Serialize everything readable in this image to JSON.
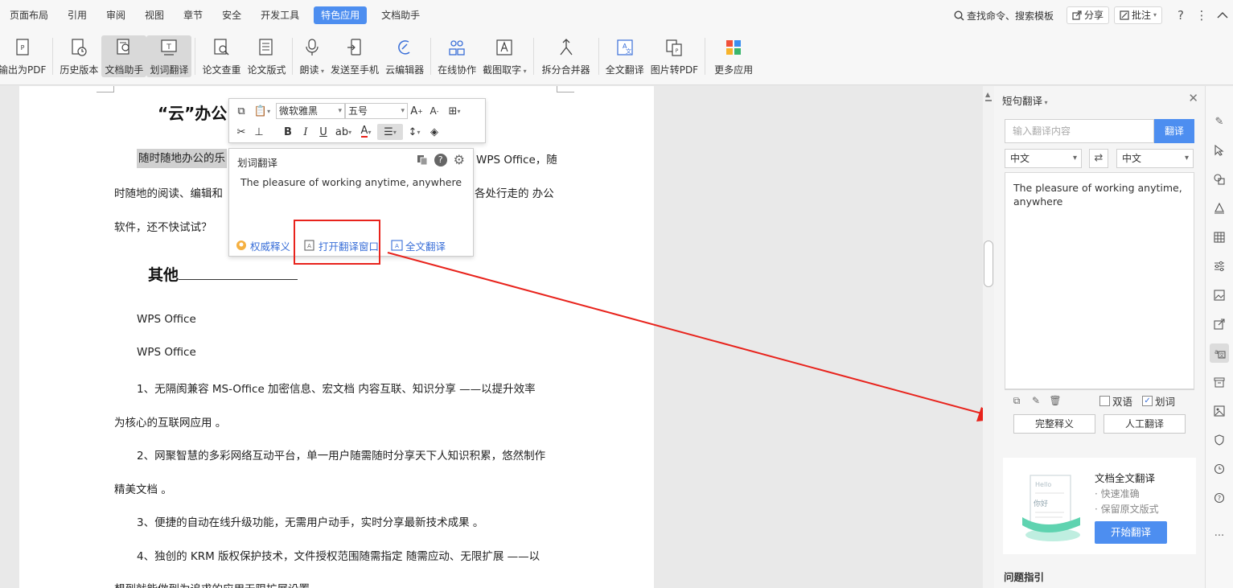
{
  "menubar": {
    "items": [
      "页面布局",
      "引用",
      "审阅",
      "视图",
      "章节",
      "安全",
      "开发工具",
      "特色应用",
      "文档助手"
    ],
    "active": "特色应用",
    "search_label": "查找命令、搜索模板",
    "share_label": "分享",
    "comment_label": "批注"
  },
  "toolbar": {
    "buttons": [
      {
        "label": "输出为PDF",
        "icon": "pdf-export-icon"
      },
      {
        "label": "历史版本",
        "icon": "history-icon"
      },
      {
        "label": "文档助手",
        "icon": "doc-assistant-icon"
      },
      {
        "label": "划词翻译",
        "icon": "word-translate-icon"
      },
      {
        "label": "论文查重",
        "icon": "plagiarism-check-icon"
      },
      {
        "label": "论文版式",
        "icon": "paper-format-icon"
      },
      {
        "label": "朗读",
        "icon": "read-aloud-icon"
      },
      {
        "label": "发送至手机",
        "icon": "send-to-phone-icon"
      },
      {
        "label": "云编辑器",
        "icon": "cloud-editor-icon"
      },
      {
        "label": "在线协作",
        "icon": "collaboration-icon"
      },
      {
        "label": "截图取字",
        "icon": "ocr-icon"
      },
      {
        "label": "拆分合并器",
        "icon": "split-merge-icon"
      },
      {
        "label": "全文翻译",
        "icon": "full-translate-icon"
      },
      {
        "label": "图片转PDF",
        "icon": "image-to-pdf-icon"
      },
      {
        "label": "更多应用",
        "icon": "more-apps-icon"
      }
    ]
  },
  "document": {
    "title": "“云”办公",
    "p1_start": "随时随地办公的乐",
    "p1_end": "WPS Office，随",
    "p2_start": "时随地的阅读、编辑和",
    "p2_end": "各处行走的 办公",
    "p3": "软件，还不快试试？",
    "h2": "其他",
    "wps1": "WPS Office",
    "wps2": "WPS Office",
    "item1a": "1、无隔阂兼容  MS-Office 加密信息、宏文档  内容互联、知识分享  ——以提升效率",
    "item1b": "为核心的互联网应用  。",
    "item2a": "2、网聚智慧的多彩网络互动平台，单一用户随需随时分享天下人知识积累，悠然制作",
    "item2b": "精美文档  。",
    "item3": "3、便捷的自动在线升级功能，无需用户动手，实时分享最新技术成果  。",
    "item4a": "4、独创的 KRM 版权保护技术，文件授权范围随需指定  随需应动、无限扩展  ——以",
    "item4b": "想到就能做到为追求的应用无限扩展设置"
  },
  "mini_toolbar": {
    "font": "微软雅黑",
    "size": "五号"
  },
  "popup": {
    "title": "划词翻译",
    "translation": "The pleasure of working anytime, anywhere",
    "link_authority": "权威释义",
    "link_open_window": "打开翻译窗口",
    "link_full": "全文翻译"
  },
  "panel": {
    "title": "短句翻译",
    "input_placeholder": "输入翻译内容",
    "translate_btn": "翻译",
    "src_lang": "中文",
    "dst_lang": "中文",
    "result": "The pleasure of working anytime, anywhere",
    "bilingual": "双语",
    "select_word": "划词",
    "full_def_btn": "完整释义",
    "human_btn": "人工翻译",
    "promo_title": "文档全文翻译",
    "promo_item1": "· 快速准确",
    "promo_item2": "· 保留原文版式",
    "promo_btn": "开始翻译",
    "promo_img_hello": "Hello",
    "promo_img_nihao": "你好",
    "guide": "问题指引"
  },
  "colors": {
    "accent": "#4d8ef0",
    "annotation_red": "#e8231c",
    "link_blue": "#3a6fd8"
  }
}
